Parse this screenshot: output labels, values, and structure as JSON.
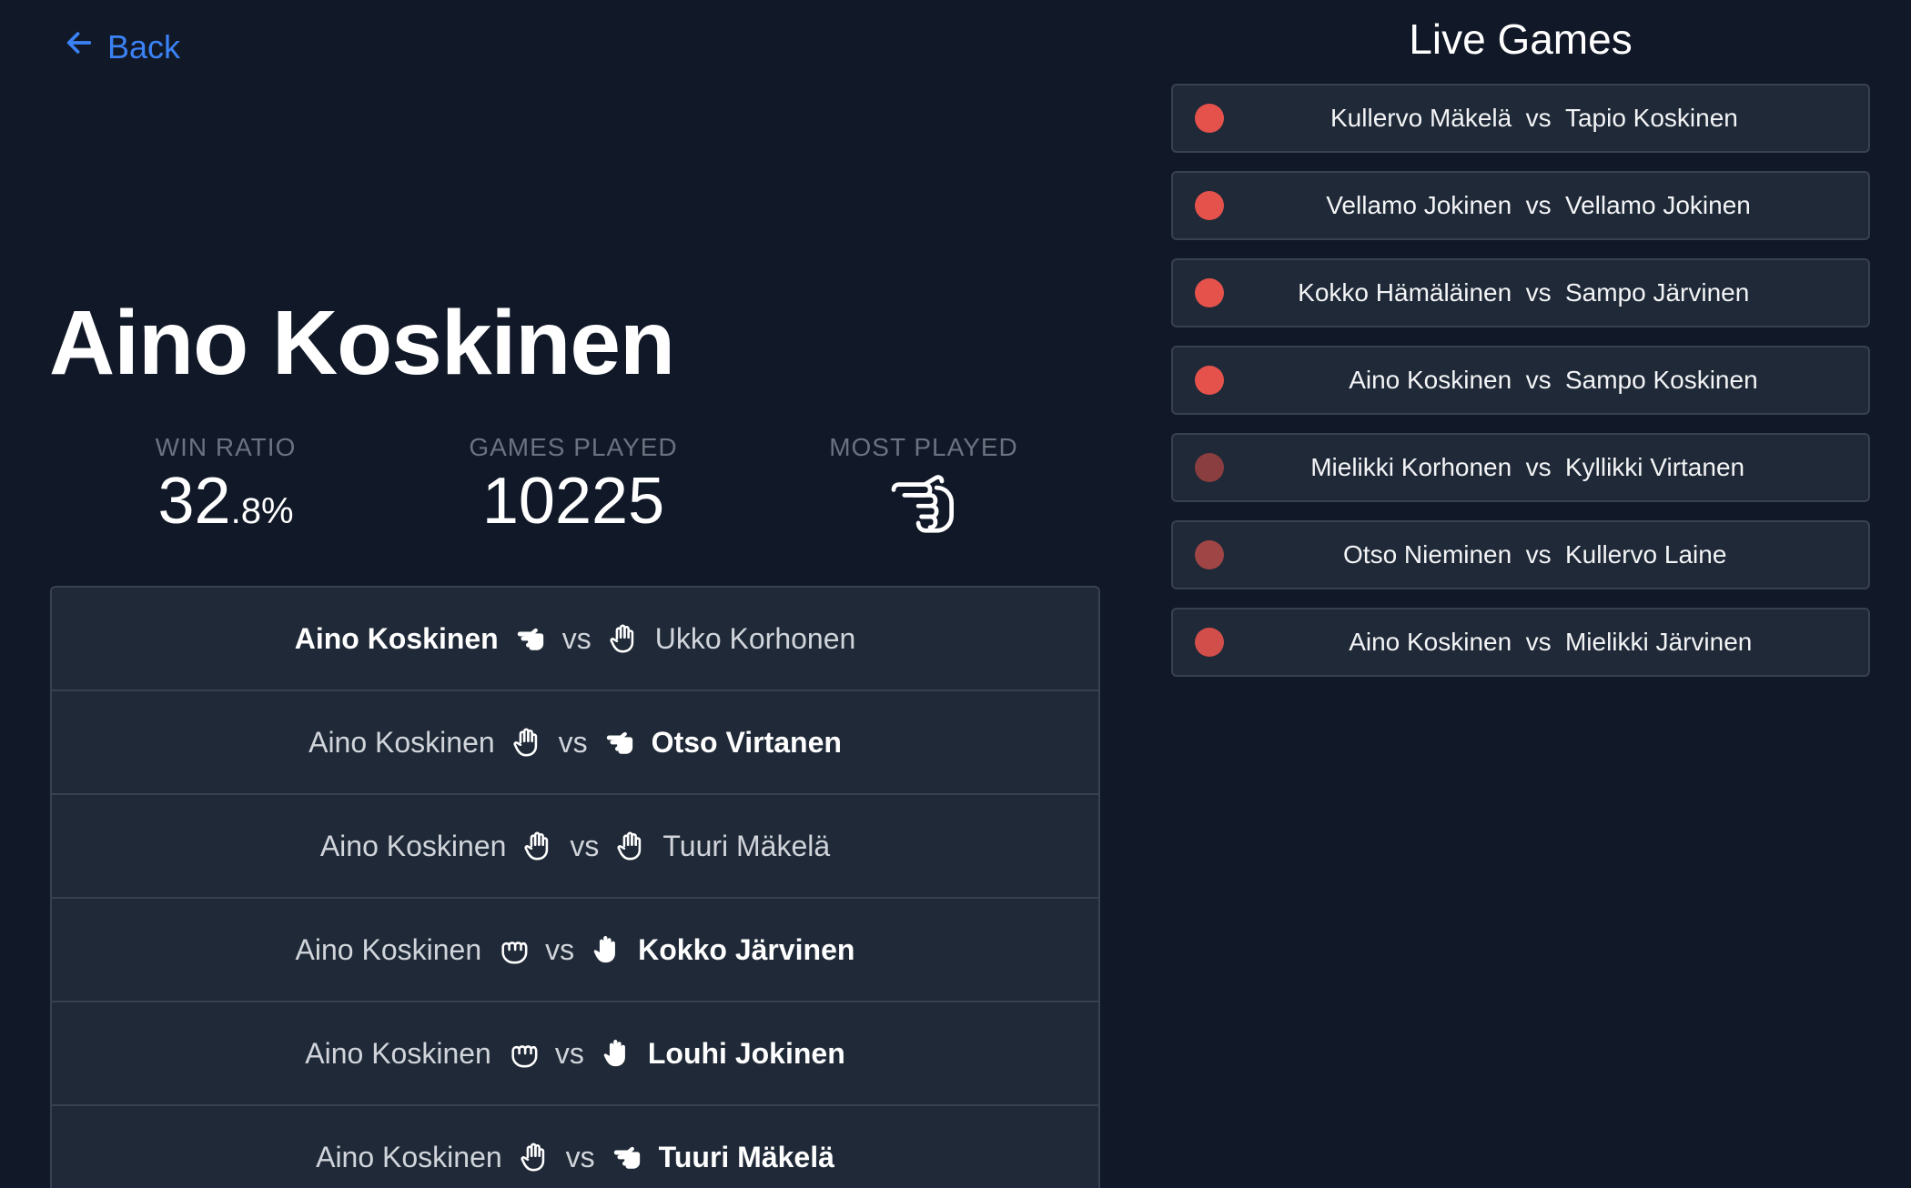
{
  "nav": {
    "back_label": "Back",
    "back_icon": "arrow-left-icon",
    "accent": "#3b82f6"
  },
  "player": {
    "name": "Aino Koskinen",
    "stats": {
      "win_ratio_label": "WIN RATIO",
      "win_ratio_int": "32",
      "win_ratio_frac": ".8%",
      "games_played_label": "GAMES PLAYED",
      "games_played": "10225",
      "most_played_label": "MOST PLAYED",
      "most_played_icon": "scissors-hand-icon"
    }
  },
  "history": [
    {
      "left": "Aino Koskinen",
      "left_move": "scissors",
      "right": "Ukko Korhonen",
      "right_move": "paper",
      "winner": "left"
    },
    {
      "left": "Aino Koskinen",
      "left_move": "paper",
      "right": "Otso Virtanen",
      "right_move": "scissors",
      "winner": "right"
    },
    {
      "left": "Aino Koskinen",
      "left_move": "paper",
      "right": "Tuuri Mäkelä",
      "right_move": "paper",
      "winner": "none"
    },
    {
      "left": "Aino Koskinen",
      "left_move": "rock",
      "right": "Kokko Järvinen",
      "right_move": "paper",
      "winner": "right"
    },
    {
      "left": "Aino Koskinen",
      "left_move": "rock",
      "right": "Louhi Jokinen",
      "right_move": "paper",
      "winner": "right"
    },
    {
      "left": "Aino Koskinen",
      "left_move": "paper",
      "right": "Tuuri Mäkelä",
      "right_move": "scissors",
      "winner": "right"
    }
  ],
  "history_vs": "vs",
  "live": {
    "title": "Live Games",
    "vs": "vs",
    "games": [
      {
        "a": "Kullervo Mäkelä",
        "b": "Tapio Koskinen",
        "dot": "#e5524c"
      },
      {
        "a": "Vellamo Jokinen",
        "b": "Vellamo Jokinen",
        "dot": "#e5524c"
      },
      {
        "a": "Kokko Hämäläinen",
        "b": "Sampo Järvinen",
        "dot": "#e5524c"
      },
      {
        "a": "Aino Koskinen",
        "b": "Sampo Koskinen",
        "dot": "#e5524c"
      },
      {
        "a": "Mielikki Korhonen",
        "b": "Kyllikki Virtanen",
        "dot": "#8a3e3f"
      },
      {
        "a": "Otso Nieminen",
        "b": "Kullervo Laine",
        "dot": "#a04546"
      },
      {
        "a": "Aino Koskinen",
        "b": "Mielikki Järvinen",
        "dot": "#d14e4a"
      }
    ]
  }
}
